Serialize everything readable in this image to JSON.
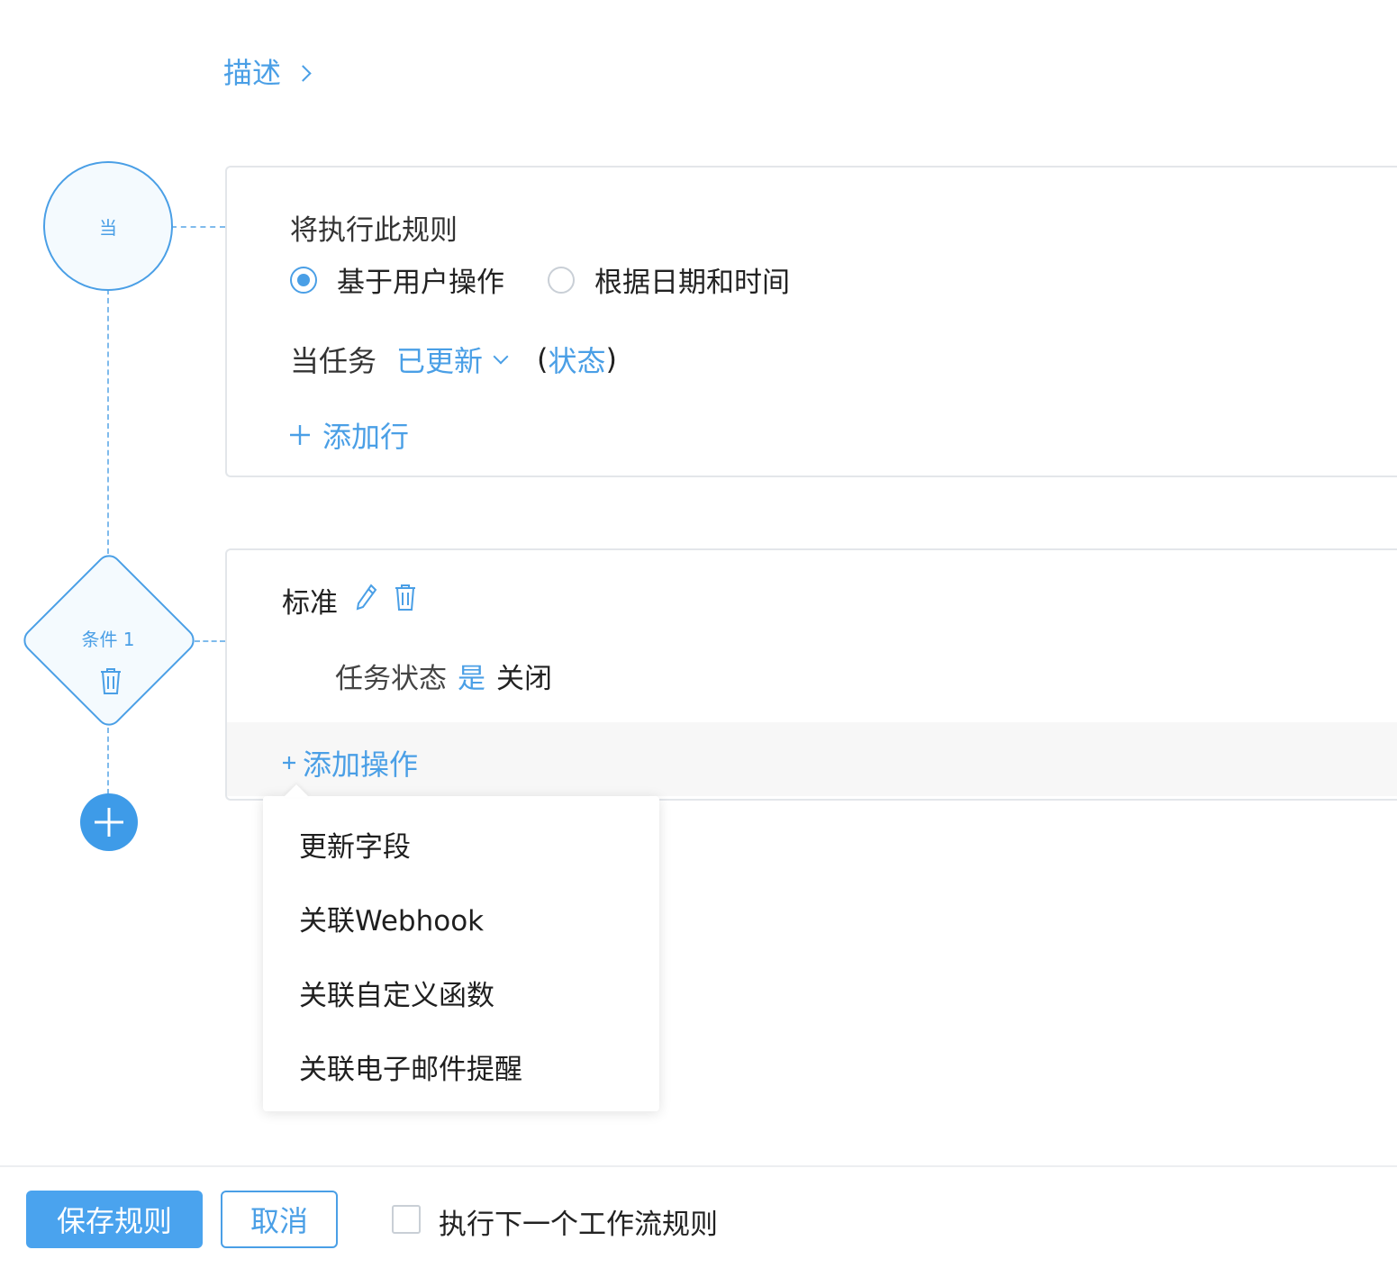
{
  "description": {
    "label": "描述"
  },
  "flow": {
    "when_node_label": "当",
    "condition_node_label": "条件 1"
  },
  "trigger_card": {
    "title": "将执行此规则",
    "options": [
      {
        "label": "基于用户操作",
        "selected": true
      },
      {
        "label": "根据日期和时间",
        "selected": false
      }
    ],
    "when_task_label": "当任务",
    "event_value": "已更新",
    "paren_open": "(",
    "field_value": "状态",
    "paren_close": ")",
    "add_row_label": "添加行"
  },
  "criteria_card": {
    "title": "标准",
    "condition": {
      "field": "任务状态",
      "operator": "是",
      "value": "关闭"
    },
    "add_action_label": "添加操作"
  },
  "action_menu": {
    "items": [
      "更新字段",
      "关联Webhook",
      "关联自定义函数",
      "关联电子邮件提醒"
    ]
  },
  "footer": {
    "save_label": "保存规则",
    "cancel_label": "取消",
    "checkbox_label": "执行下一个工作流规则",
    "checkbox_checked": false
  },
  "colors": {
    "accent": "#4a9fe6",
    "primary_button": "#4aa3ee",
    "text": "#333333",
    "border": "#e3e6ea"
  }
}
